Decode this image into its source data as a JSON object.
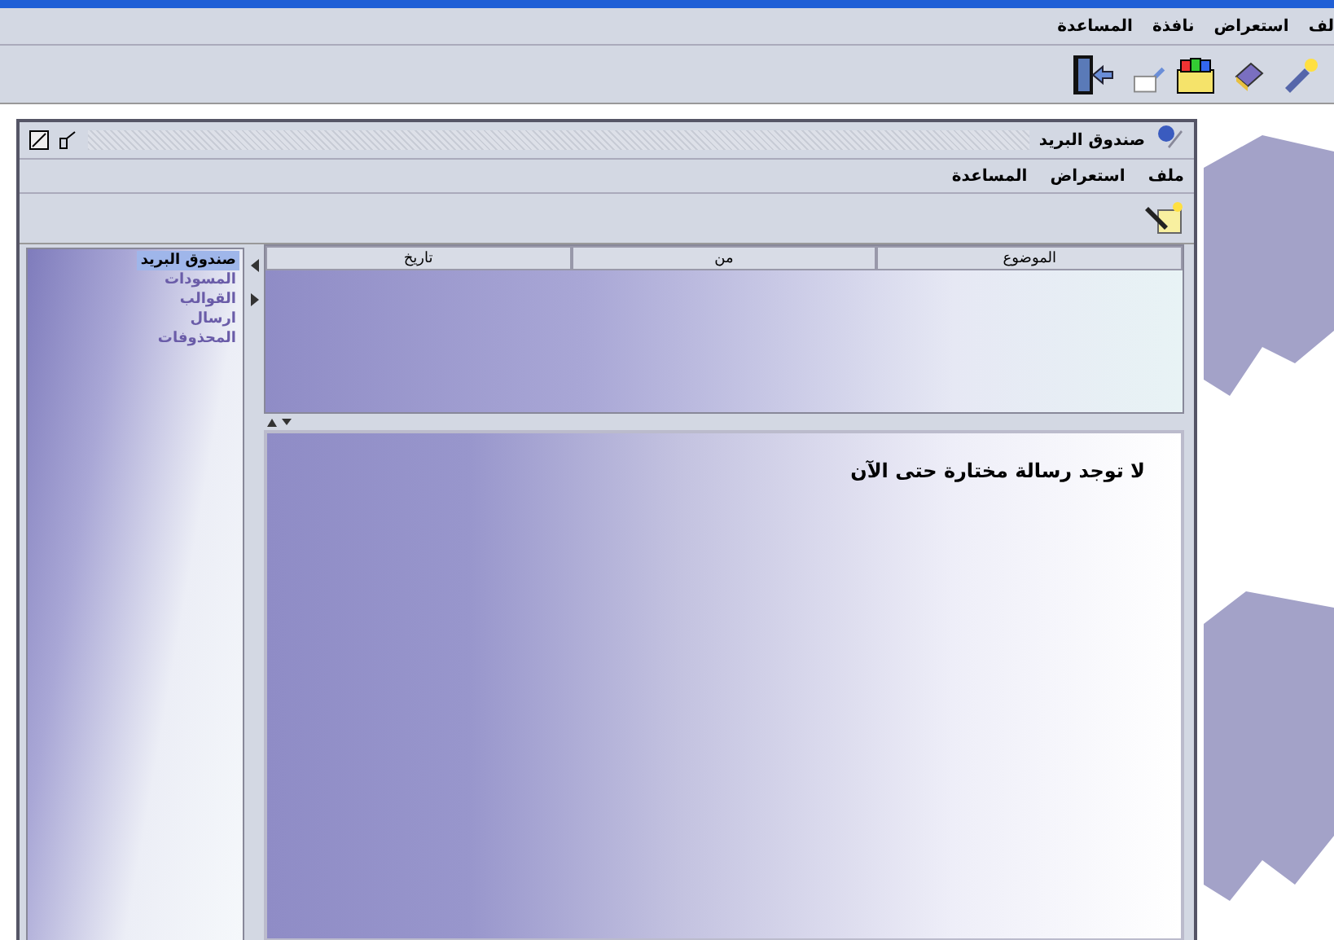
{
  "app_menu": [
    {
      "label": "لف"
    },
    {
      "label": "استعراض"
    },
    {
      "label": "نافذة"
    },
    {
      "label": "المساعدة"
    }
  ],
  "window": {
    "title": "صندوق البريد",
    "menu": [
      {
        "label": "ملف"
      },
      {
        "label": "استعراض"
      },
      {
        "label": "المساعدة"
      }
    ]
  },
  "sidebar": {
    "items": [
      {
        "label": "صندوق البريد",
        "selected": true
      },
      {
        "label": "المسودات",
        "selected": false
      },
      {
        "label": "القوالب",
        "selected": false
      },
      {
        "label": "ارسال",
        "selected": false
      },
      {
        "label": "المحذوفات",
        "selected": false
      }
    ]
  },
  "table": {
    "columns": [
      "الموضوع",
      "من",
      "تاريخ"
    ]
  },
  "preview": {
    "message": "لا توجد رسالة مختارة حتى الآن"
  }
}
